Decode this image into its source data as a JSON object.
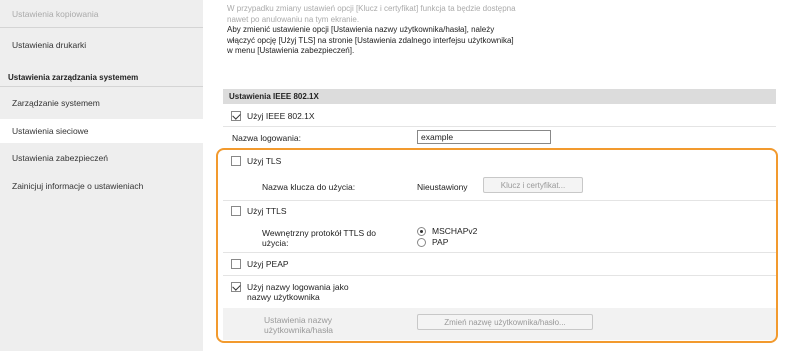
{
  "sidebar": {
    "items": [
      {
        "label": "Ustawienia kopiowania",
        "state": "faded"
      },
      {
        "label": "Ustawienia drukarki",
        "state": "normal"
      },
      {
        "label": "Ustawienia zarządzania systemem",
        "state": "header"
      },
      {
        "label": "Zarządzanie systemem",
        "state": "normal"
      },
      {
        "label": "Ustawienia sieciowe",
        "state": "active"
      },
      {
        "label": "Ustawienia zabezpieczeń",
        "state": "normal"
      },
      {
        "label": "Zainicjuj informacje o ustawieniach",
        "state": "normal"
      }
    ]
  },
  "note": {
    "line1": "W przypadku zmiany ustawień opcji [Klucz i certyfikat] funkcja ta będzie dostępna",
    "line2": "nawet po anulowaniu na tym ekranie.",
    "line3": "Aby zmienić ustawienie opcji [Ustawienia nazwy użytkownika/hasła], należy",
    "line4": "włączyć opcję [Użyj TLS] na stronie [Ustawienia zdalnego interfejsu użytkownika]",
    "line5": "w menu [Ustawienia zabezpieczeń]."
  },
  "section": {
    "title": "Ustawienia IEEE 802.1X"
  },
  "form": {
    "use_ieee_label": "Użyj IEEE 802.1X",
    "use_ieee_checked": true,
    "login_name_label": "Nazwa logowania:",
    "login_name_value": "example",
    "use_tls_label": "Użyj TLS",
    "use_tls_checked": false,
    "key_label": "Nazwa klucza do użycia:",
    "key_value": "Nieustawiony",
    "key_button": "Klucz i certyfikat...",
    "use_ttls_label": "Użyj TTLS",
    "use_ttls_checked": false,
    "ttls_protocol_label_1": "Wewnętrzny protokół TTLS do",
    "ttls_protocol_label_2": "użycia:",
    "ttls_options": [
      {
        "label": "MSCHAPv2",
        "selected": true
      },
      {
        "label": "PAP",
        "selected": false
      }
    ],
    "use_peap_label": "Użyj PEAP",
    "use_peap_checked": false,
    "use_login_as_user_label_1": "Użyj nazwy logowania jako",
    "use_login_as_user_label_2": "nazwy użytkownika",
    "use_login_as_user_checked": true,
    "user_pass_label_1": "Ustawienia nazwy",
    "user_pass_label_2": "użytkownika/hasła",
    "user_pass_button": "Zmień nazwę użytkownika/hasło..."
  },
  "colors": {
    "highlight": "#f29a2e",
    "sidebar_bg": "#eeeeee",
    "section_bg": "#dcdcdc"
  }
}
